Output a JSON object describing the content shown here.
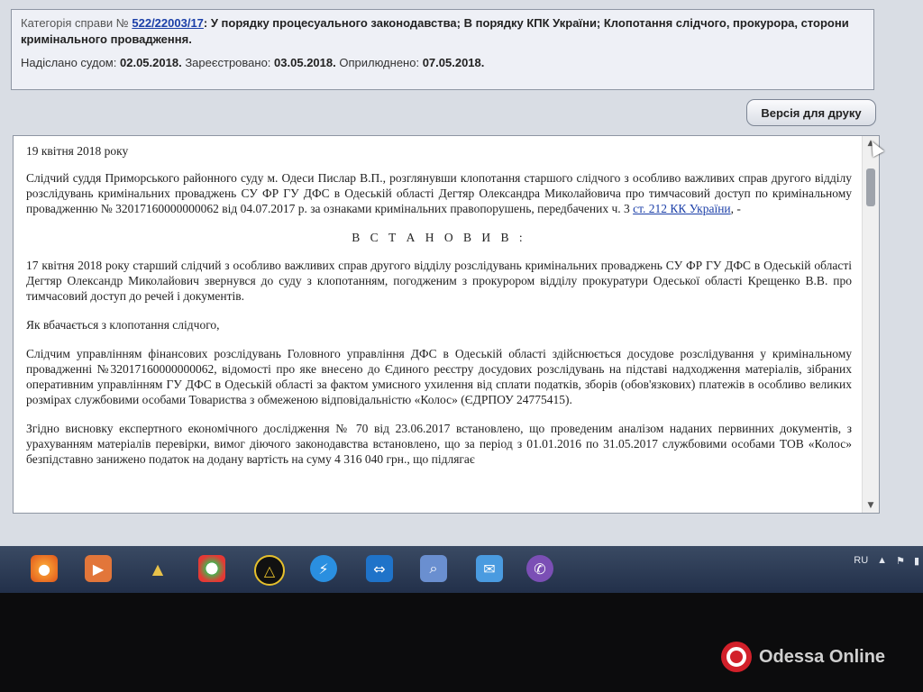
{
  "header": {
    "category_label": "Категорія справи №",
    "case_link": "522/22003/17",
    "category_text": ": У порядку процесуального законодавства; В порядку КПК України; Клопотання слідчого, прокурора, сторони кримінального провадження.",
    "sent_label": "Надіслано судом:",
    "sent_date": "02.05.2018.",
    "registered_label": "Зареєстровано:",
    "registered_date": "03.05.2018.",
    "published_label": "Оприлюднено:",
    "published_date": "07.05.2018."
  },
  "print_button": "Версія для друку",
  "document": {
    "date": "19 квітня 2018 року",
    "intro": "Слідчий суддя Приморського районного суду м. Одеси Пислар В.П., розглянувши клопотання старшого слідчого з особливо важливих справ другого відділу розслідувань кримінальних проваджень СУ ФР ГУ ДФС в Одеській області Дегтяр Олександра Миколайовича про тимчасовий доступ по кримінальному провадженню № 32017160000000062 від 04.07.2017 р. за ознаками кримінальних правопорушень, передбачених ч. 3",
    "intro_link": "ст. 212 КК України",
    "intro_end": ", -",
    "heading": "В С Т А Н О В И В :",
    "para1": "17 квітня 2018 року старший слідчий з особливо важливих справ другого відділу розслідувань кримінальних проваджень СУ ФР ГУ ДФС в Одеській області Дегтяр Олександр Миколайович звернувся до суду з клопотанням, погодженим з прокурором відділу прокуратури Одеської області Крещенко В.В. про тимчасовий доступ до речей і документів.",
    "para2": "Як вбачається з клопотання слідчого,",
    "para3": "Слідчим управлінням фінансових розслідувань Головного управління ДФС в Одеській області здійснюється досудове розслідування у кримінальному провадженні №32017160000000062, відомості про яке внесено до Єдиного реєстру досудових розслідувань на підставі надходження матеріалів, зібраних оперативним управлінням ГУ ДФС в Одеській області за фактом умисного ухилення від сплати податків, зборів (обов'язкових) платежів в особливо великих розмірах службовими особами Товариства з обмеженою відповідальністю «Колос» (ЄДРПОУ 24775415).",
    "para4": "Згідно висновку експертного економічного дослідження № 70 від 23.06.2017 встановлено, що проведеним аналізом наданих первинних документів, з урахуванням матеріалів перевірки, вимог діючого законодавства встановлено, що за період з 01.01.2016 по 31.05.2017 службовими особами ТОВ «Колос» безпідставно занижено податок на додану вартість на суму 4 316 040 грн., що підлягає"
  },
  "taskbar": {
    "icons": [
      "firefox-icon",
      "media-player-icon",
      "drive-icon",
      "picasa-icon",
      "app-triangle-icon",
      "flash-icon",
      "teamviewer-icon",
      "search-tool-icon",
      "messenger-icon",
      "viber-icon"
    ],
    "tray_lang": "RU"
  },
  "watermark": "Odessa Online",
  "colors": {
    "link": "#1b3fa8",
    "taskbar": "#2c3a54",
    "watermark_red": "#d2202a"
  }
}
